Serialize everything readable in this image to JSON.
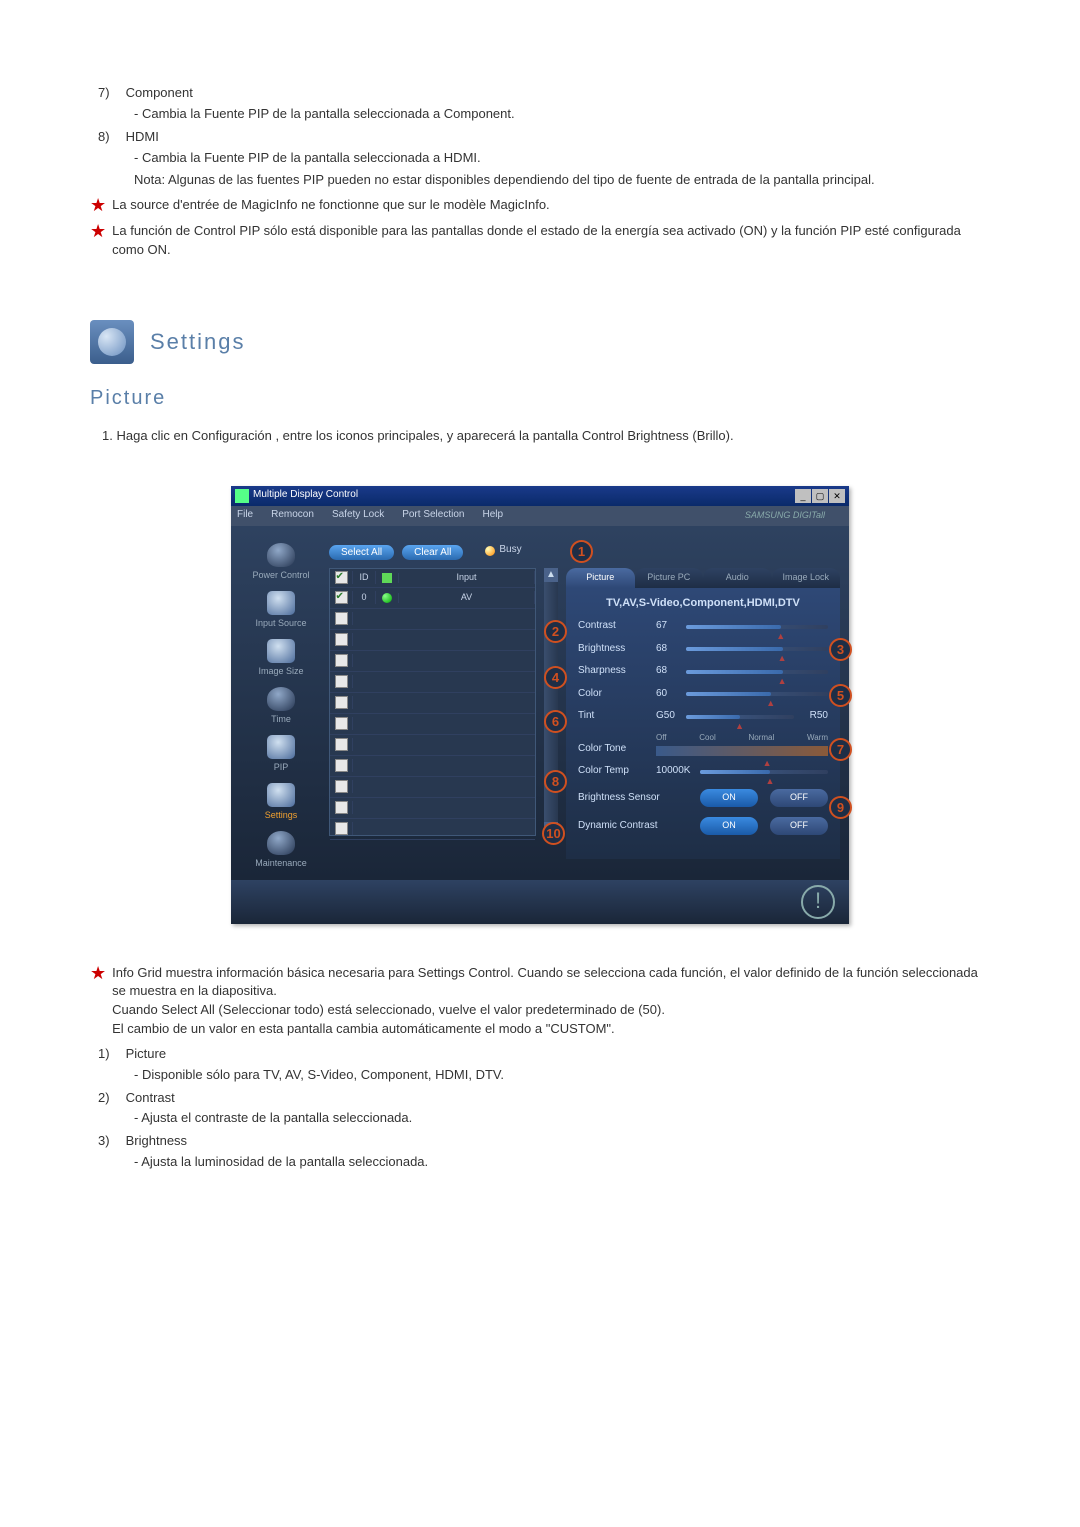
{
  "top_items": [
    {
      "num": "7)",
      "label": "Component",
      "desc": "Cambia la Fuente PIP de la pantalla seleccionada a Component."
    },
    {
      "num": "8)",
      "label": "HDMI",
      "desc": "Cambia la Fuente PIP de la pantalla seleccionada a HDMI."
    }
  ],
  "note": "Nota: Algunas de las fuentes PIP pueden no estar disponibles dependiendo del tipo de fuente de entrada de la pantalla principal.",
  "star1": "La source d'entrée de MagicInfo ne fonctionne que sur le modèle MagicInfo.",
  "star2": "La función de Control PIP sólo está disponible para las pantallas donde el estado de la energía sea activado (ON) y la función PIP esté configurada como ON.",
  "section_title": "Settings",
  "subsection": "Picture",
  "intro_num": "1.",
  "intro": "Haga clic en Configuración , entre los iconos principales, y aparecerá la pantalla Control Brightness (Brillo).",
  "app": {
    "title": "Multiple Display Control",
    "menu": [
      "File",
      "Remocon",
      "Safety Lock",
      "Port Selection",
      "Help"
    ],
    "brand": "SAMSUNG DIGITall",
    "sidebar": [
      {
        "label": "Power Control"
      },
      {
        "label": "Input Source"
      },
      {
        "label": "Image Size"
      },
      {
        "label": "Time"
      },
      {
        "label": "PIP"
      },
      {
        "label": "Settings"
      },
      {
        "label": "Maintenance"
      }
    ],
    "select_all": "Select All",
    "clear_all": "Clear All",
    "busy": "Busy",
    "grid_head": {
      "id": "ID",
      "input": "Input"
    },
    "grid_row0": {
      "id": "0",
      "input": "AV"
    },
    "tabs": [
      "Picture",
      "Picture PC",
      "Audio",
      "Image Lock"
    ],
    "pane_subtitle": "TV,AV,S-Video,Component,HDMI,DTV",
    "sliders": {
      "contrast": {
        "label": "Contrast",
        "val": "67"
      },
      "brightness": {
        "label": "Brightness",
        "val": "68"
      },
      "sharpness": {
        "label": "Sharpness",
        "val": "68"
      },
      "color": {
        "label": "Color",
        "val": "60"
      },
      "tint": {
        "label": "Tint",
        "lval": "G50",
        "rval": "R50"
      }
    },
    "color_tone": {
      "label": "Color Tone",
      "opts": [
        "Off",
        "Cool",
        "Normal",
        "Warm"
      ]
    },
    "color_temp": {
      "label": "Color Temp",
      "val": "10000K"
    },
    "bsensor": {
      "label": "Brightness Sensor",
      "on": "ON",
      "off": "OFF"
    },
    "dcontrast": {
      "label": "Dynamic Contrast",
      "on": "ON",
      "off": "OFF"
    }
  },
  "bottom_star": {
    "l1": "Info Grid muestra información básica necesaria para Settings Control. Cuando se selecciona cada función, el valor definido de la función seleccionada se muestra en la diapositiva.",
    "l2": "Cuando Select All (Seleccionar todo) está seleccionado, vuelve el valor predeterminado de (50).",
    "l3": "El cambio de un valor en esta pantalla cambia automáticamente el modo a \"CUSTOM\"."
  },
  "bottom_items": [
    {
      "num": "1)",
      "label": "Picture",
      "desc": "Disponible sólo para TV, AV, S-Video, Component, HDMI, DTV."
    },
    {
      "num": "2)",
      "label": "Contrast",
      "desc": "Ajusta el contraste de la pantalla seleccionada."
    },
    {
      "num": "3)",
      "label": "Brightness",
      "desc": "Ajusta la luminosidad de la pantalla seleccionada."
    }
  ]
}
